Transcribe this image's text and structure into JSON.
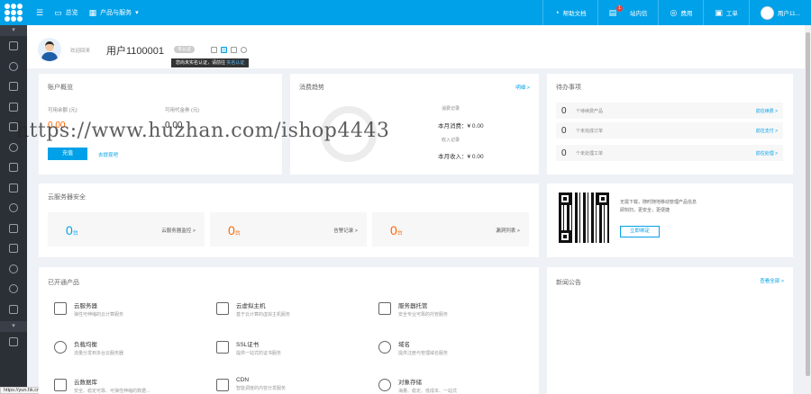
{
  "topbar": {
    "menu_icon": "hamburger-icon",
    "console_label": "总览",
    "products_label": "产品与服务",
    "help_label": "帮助文档",
    "messages_label": "站内信",
    "messages_count": "1",
    "billing_label": "费用",
    "tickets_label": "工单",
    "user_label": "用户11..."
  },
  "header": {
    "greeting": "欢迎回来",
    "username": "用户1100001",
    "verify_tag": "未认证",
    "tooltip_text": "您尚未实名认证，请前往",
    "tooltip_link": "实名认证"
  },
  "account": {
    "title": "账户概览",
    "balance_label": "可用余额 (元)",
    "balance_value": "0.00",
    "voucher_label": "可用代金券 (元)",
    "voucher_value": "0.00",
    "recharge_button": "充值",
    "withdraw_link": "去提现吧"
  },
  "consumption": {
    "title": "消费趋势",
    "detail_link": "明细 >",
    "legend_spend": "消费记录",
    "month_spend": "本月消费：¥ 0.00",
    "legend_income": "收入记录",
    "month_income": "本月收入：¥ 0.00"
  },
  "todo": {
    "title": "待办事项",
    "items": [
      {
        "count": "0",
        "text": "个待续费产品",
        "link": "前往续费 >"
      },
      {
        "count": "0",
        "text": "个未完成订单",
        "link": "前往支付 >"
      },
      {
        "count": "0",
        "text": "个未处理工单",
        "link": "前往处理 >"
      }
    ]
  },
  "security": {
    "title": "云服务器安全",
    "boxes": [
      {
        "count": "0",
        "unit": "台",
        "label": "云服务器监控 >",
        "color": "#00a1e9"
      },
      {
        "count": "0",
        "unit": "台",
        "label": "告警记录 >",
        "color": "#f60"
      },
      {
        "count": "0",
        "unit": "台",
        "label": "漏洞列表 >",
        "color": "#f60"
      }
    ]
  },
  "app_promo": {
    "text_line1": "无需下载，随时随地移动管理产品信息",
    "text_line2": "即刻扫，更安全，更便捷",
    "button": "立即绑定"
  },
  "products": {
    "title": "已开通产品",
    "items": [
      {
        "name": "云服务器",
        "desc": "弹性可伸缩的云计算服务",
        "icon": "server-icon"
      },
      {
        "name": "云虚拟主机",
        "desc": "基于云计算的虚拟主机服务",
        "icon": "cube-icon"
      },
      {
        "name": "服务器托管",
        "desc": "安全专业可靠的托管服务",
        "icon": "rack-icon"
      },
      {
        "name": "负载均衡",
        "desc": "流量分发到多台云服务器",
        "icon": "nodes-icon"
      },
      {
        "name": "SSL证书",
        "desc": "提供一站式的证书服务",
        "icon": "certificate-icon"
      },
      {
        "name": "域名",
        "desc": "提供注册与管理域名服务",
        "icon": "globe-icon"
      },
      {
        "name": "云数据库",
        "desc": "安全、稳定可靠、可弹性伸缩的数据...",
        "icon": "database-icon"
      },
      {
        "name": "CDN",
        "desc": "智能调度的内容分发服务",
        "icon": "cdn-icon"
      },
      {
        "name": "对象存储",
        "desc": "海量、稳定、低成本、一站式",
        "icon": "cloud-storage-icon"
      }
    ]
  },
  "news": {
    "title": "新闻公告",
    "more_link": "查看全部 >"
  },
  "watermark": "https://www.huzhan.com/ishop4443",
  "status_url": "https://yun.hk.cn/user/"
}
